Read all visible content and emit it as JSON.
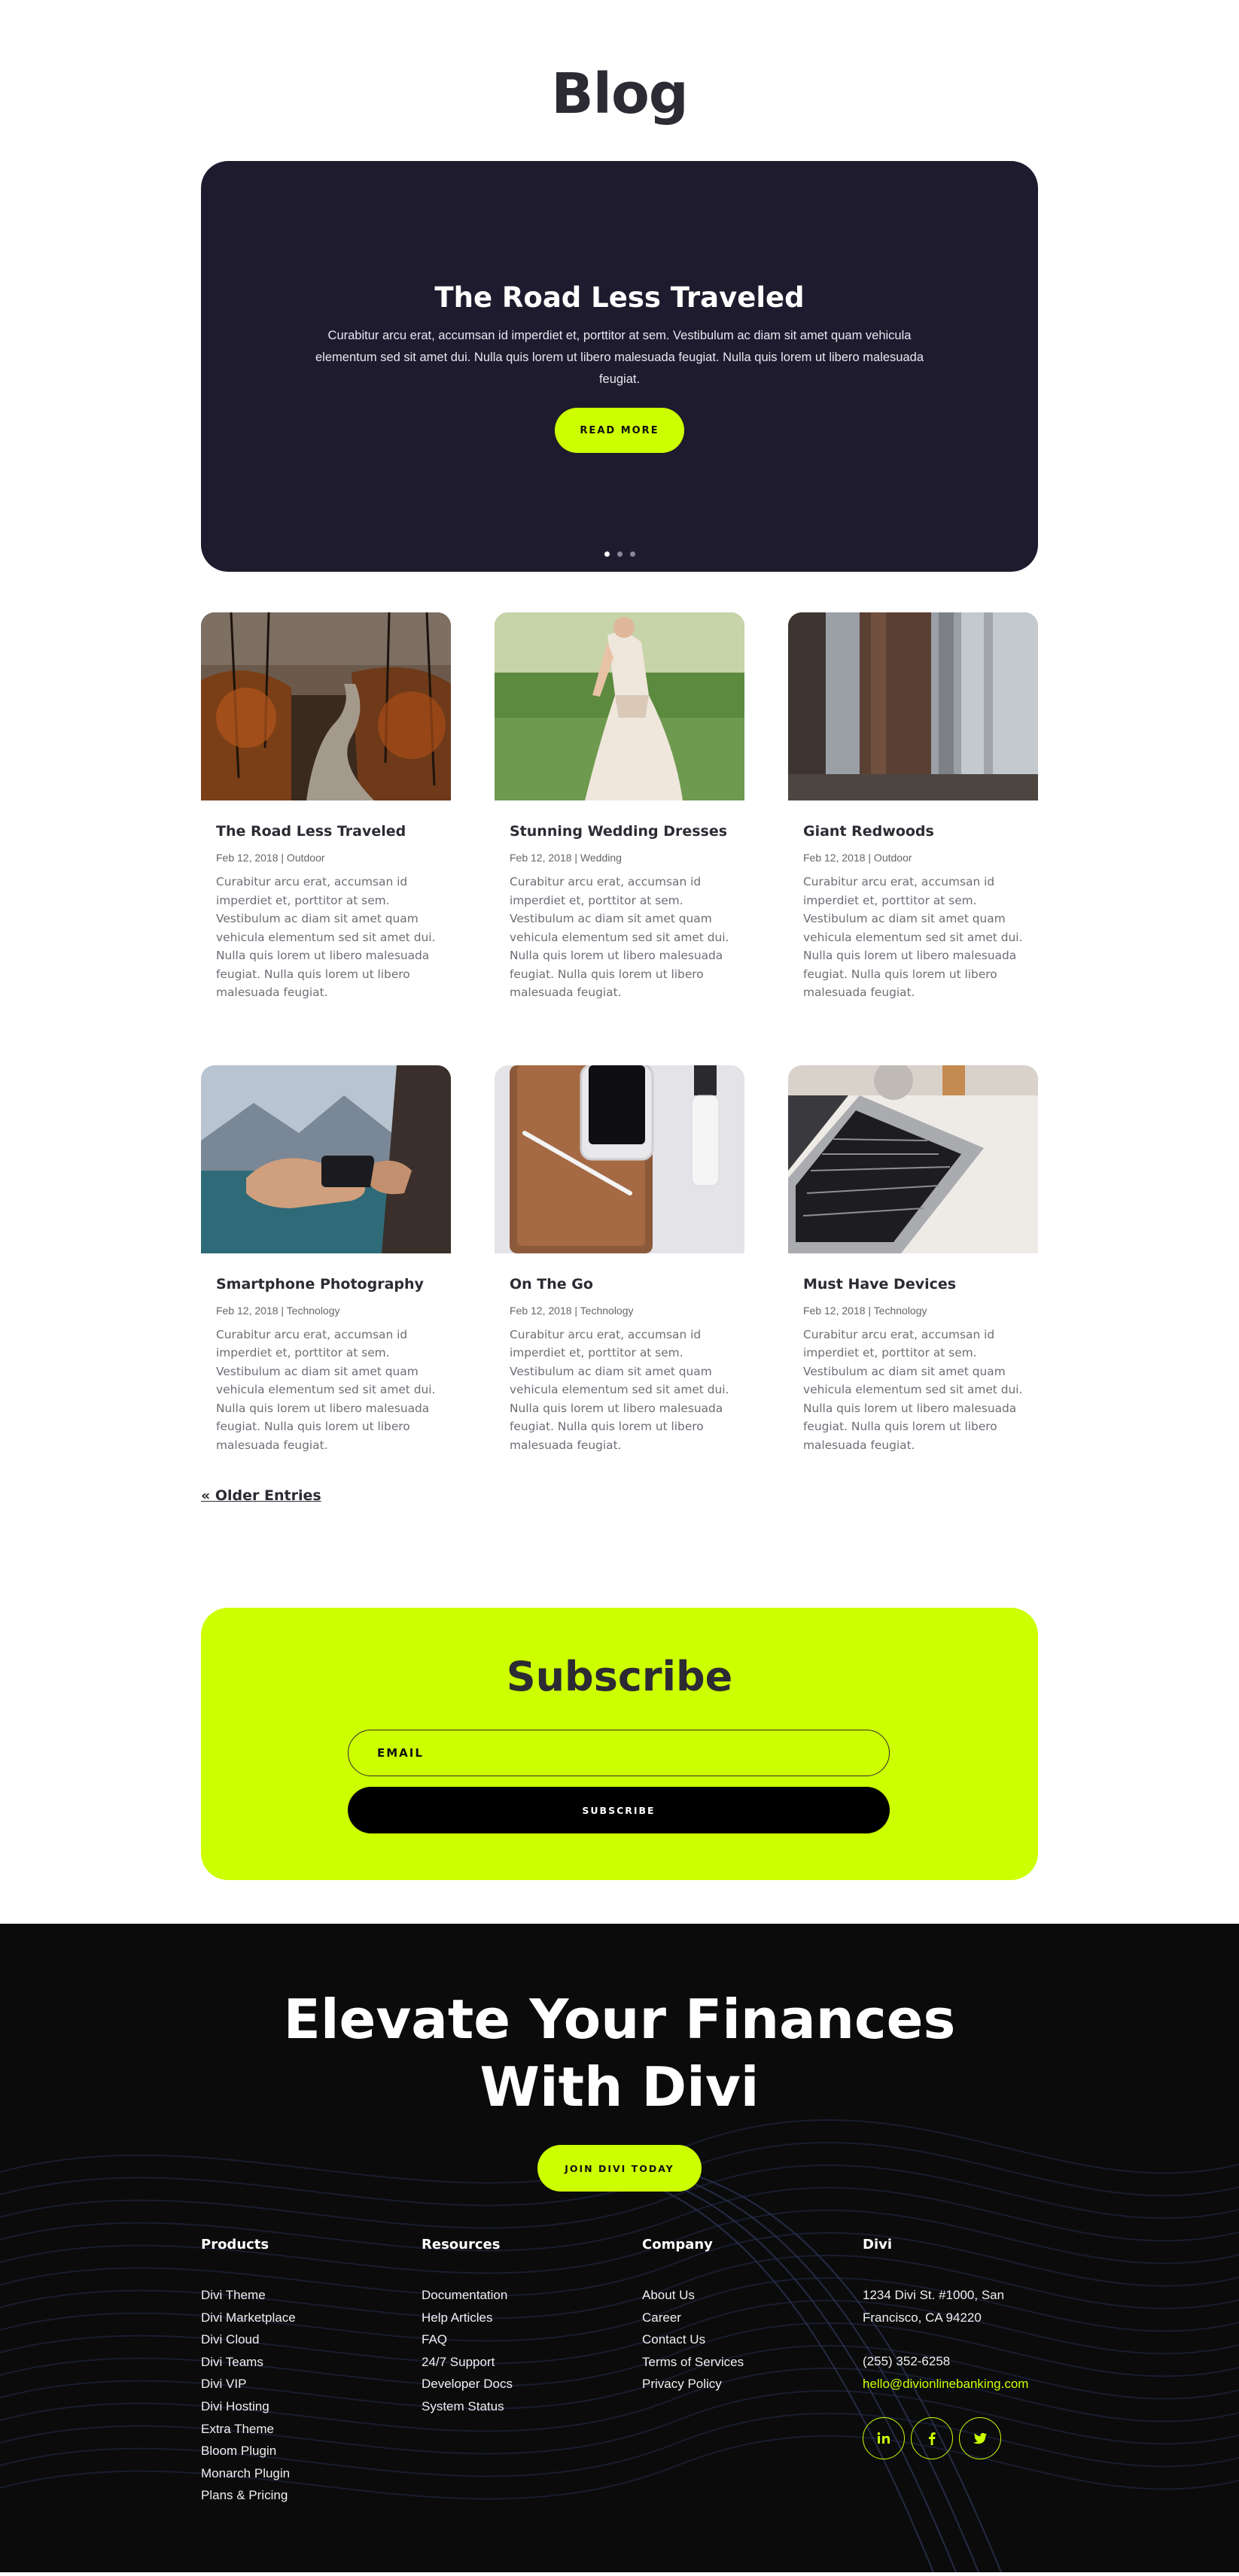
{
  "page": {
    "title": "Blog"
  },
  "hero": {
    "title": "The Road Less Traveled",
    "text": "Curabitur arcu erat, accumsan id imperdiet et, porttitor at sem. Vestibulum ac diam sit amet quam vehicula elementum sed sit amet dui. Nulla quis lorem ut libero malesuada feugiat. Nulla quis lorem ut libero malesuada feugiat.",
    "button": "READ MORE",
    "slides": 3,
    "active_slide": 1
  },
  "posts": [
    {
      "title": "The Road Less Traveled",
      "meta": "Feb 12, 2018 | Outdoor",
      "image": "forest-road-photo",
      "excerpt": "Curabitur arcu erat, accumsan id imperdiet et, porttitor at sem. Vestibulum ac diam sit amet quam vehicula elementum sed sit amet dui. Nulla quis lorem ut libero malesuada feugiat. Nulla quis lorem ut libero malesuada feugiat."
    },
    {
      "title": "Stunning Wedding Dresses",
      "meta": "Feb 12, 2018 | Wedding",
      "image": "wedding-dress-photo",
      "excerpt": "Curabitur arcu erat, accumsan id imperdiet et, porttitor at sem. Vestibulum ac diam sit amet quam vehicula elementum sed sit amet dui. Nulla quis lorem ut libero malesuada feugiat. Nulla quis lorem ut libero malesuada feugiat."
    },
    {
      "title": "Giant Redwoods",
      "meta": "Feb 12, 2018 | Outdoor",
      "image": "redwood-trees-photo",
      "excerpt": "Curabitur arcu erat, accumsan id imperdiet et, porttitor at sem. Vestibulum ac diam sit amet quam vehicula elementum sed sit amet dui. Nulla quis lorem ut libero malesuada feugiat. Nulla quis lorem ut libero malesuada feugiat."
    },
    {
      "title": "Smartphone Photography",
      "meta": "Feb 12, 2018 | Technology",
      "image": "phone-photography-photo",
      "excerpt": "Curabitur arcu erat, accumsan id imperdiet et, porttitor at sem. Vestibulum ac diam sit amet quam vehicula elementum sed sit amet dui. Nulla quis lorem ut libero malesuada feugiat. Nulla quis lorem ut libero malesuada feugiat."
    },
    {
      "title": "On The Go",
      "meta": "Feb 12, 2018 | Technology",
      "image": "tablet-phone-desk-photo",
      "excerpt": "Curabitur arcu erat, accumsan id imperdiet et, porttitor at sem. Vestibulum ac diam sit amet quam vehicula elementum sed sit amet dui. Nulla quis lorem ut libero malesuada feugiat. Nulla quis lorem ut libero malesuada feugiat."
    },
    {
      "title": "Must Have Devices",
      "meta": "Feb 12, 2018 | Technology",
      "image": "laptop-keyboard-photo",
      "excerpt": "Curabitur arcu erat, accumsan id imperdiet et, porttitor at sem. Vestibulum ac diam sit amet quam vehicula elementum sed sit amet dui. Nulla quis lorem ut libero malesuada feugiat. Nulla quis lorem ut libero malesuada feugiat."
    }
  ],
  "pagination": {
    "older": "« Older Entries"
  },
  "subscribe": {
    "title": "Subscribe",
    "email_placeholder": "EMAIL",
    "button": "SUBSCRIBE"
  },
  "footer": {
    "cta_line1": "Elevate Your Finances",
    "cta_line2": "With Divi",
    "cta_button": "JOIN DIVI TODAY",
    "products": {
      "title": "Products",
      "items": [
        "Divi Theme",
        "Divi Marketplace",
        "Divi Cloud",
        "Divi Teams",
        "Divi VIP",
        "Divi Hosting",
        "Extra Theme",
        "Bloom Plugin",
        "Monarch Plugin",
        "Plans & Pricing"
      ]
    },
    "resources": {
      "title": "Resources",
      "items": [
        "Documentation",
        "Help Articles",
        "FAQ",
        "24/7 Support",
        "Developer Docs",
        "System Status"
      ]
    },
    "company": {
      "title": "Company",
      "items": [
        "About Us",
        "Career",
        "Contact Us",
        "Terms of Services",
        "Privacy Policy"
      ]
    },
    "divi": {
      "title": "Divi",
      "address_line1": "1234 Divi St. #1000, San",
      "address_line2": "Francisco, CA 94220",
      "phone": "(255) 352-6258",
      "email": "hello@divionlinebanking.com",
      "socials": [
        "linkedin-icon",
        "facebook-icon",
        "twitter-icon"
      ]
    }
  },
  "colors": {
    "accent": "#ccff00",
    "hero_bg": "#1f1b2e",
    "footer_bg": "#0b0b0c",
    "text_dark": "#2c2a33"
  }
}
